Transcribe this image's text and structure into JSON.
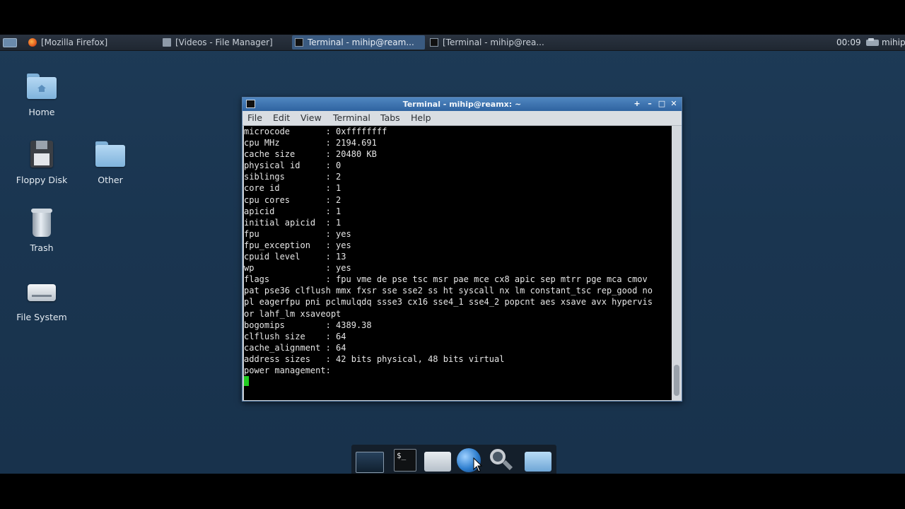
{
  "panel": {
    "tasks": [
      {
        "label": "[Mozilla Firefox]",
        "icon": "firefox-icon"
      },
      {
        "label": "[Videos - File Manager]",
        "icon": "file-manager-icon"
      },
      {
        "label": "Terminal - mihip@ream...",
        "icon": "terminal-icon",
        "active": true
      },
      {
        "label": "[Terminal - mihip@rea...",
        "icon": "terminal-icon"
      }
    ],
    "clock": "00:09",
    "user": "mihip"
  },
  "desktop_icons": [
    {
      "label": "Home"
    },
    {
      "label": "Floppy Disk"
    },
    {
      "label": "Other"
    },
    {
      "label": "Trash"
    },
    {
      "label": "File System"
    }
  ],
  "terminal": {
    "title": "Terminal - mihip@reamx: ~",
    "menu": [
      "File",
      "Edit",
      "View",
      "Terminal",
      "Tabs",
      "Help"
    ],
    "lines": [
      "microcode       : 0xffffffff",
      "cpu MHz         : 2194.691",
      "cache size      : 20480 KB",
      "physical id     : 0",
      "siblings        : 2",
      "core id         : 1",
      "cpu cores       : 2",
      "apicid          : 1",
      "initial apicid  : 1",
      "fpu             : yes",
      "fpu_exception   : yes",
      "cpuid level     : 13",
      "wp              : yes",
      "flags           : fpu vme de pse tsc msr pae mce cx8 apic sep mtrr pge mca cmov",
      "pat pse36 clflush mmx fxsr sse sse2 ss ht syscall nx lm constant_tsc rep_good no",
      "pl eagerfpu pni pclmulqdq ssse3 cx16 sse4_1 sse4_2 popcnt aes xsave avx hypervis",
      "or lahf_lm xsaveopt",
      "bogomips        : 4389.38",
      "clflush size    : 64",
      "cache_alignment : 64",
      "address sizes   : 42 bits physical, 48 bits virtual",
      "power management:",
      ""
    ]
  },
  "dock": {
    "items": [
      "show-desktop-icon",
      "terminal-icon",
      "home-folder-icon",
      "web-browser-icon",
      "search-icon",
      "folder-icon"
    ],
    "terminal_glyph": "$_"
  },
  "colors": {
    "desktop": "#1a3550",
    "titlebar": "#2f63a0",
    "cursor": "#22cc22"
  }
}
